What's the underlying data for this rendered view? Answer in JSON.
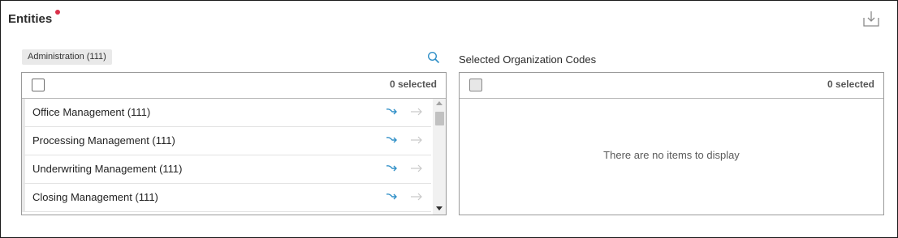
{
  "header": {
    "title": "Entities",
    "export_icon": "export-download-icon"
  },
  "left": {
    "breadcrumb": "Administration (111)",
    "search_icon": "search-icon",
    "selected_count": "0 selected",
    "items": [
      {
        "label": "Office Management (111)"
      },
      {
        "label": "Processing Management (111)"
      },
      {
        "label": "Underwriting Management (111)"
      },
      {
        "label": "Closing Management (111)"
      }
    ]
  },
  "right": {
    "title": "Selected Organization Codes",
    "selected_count": "0 selected",
    "empty_message": "There are no items to display"
  },
  "colors": {
    "accent": "#2f8fc7",
    "required": "#d9304a",
    "muted_arrow": "#c8c8c8"
  }
}
